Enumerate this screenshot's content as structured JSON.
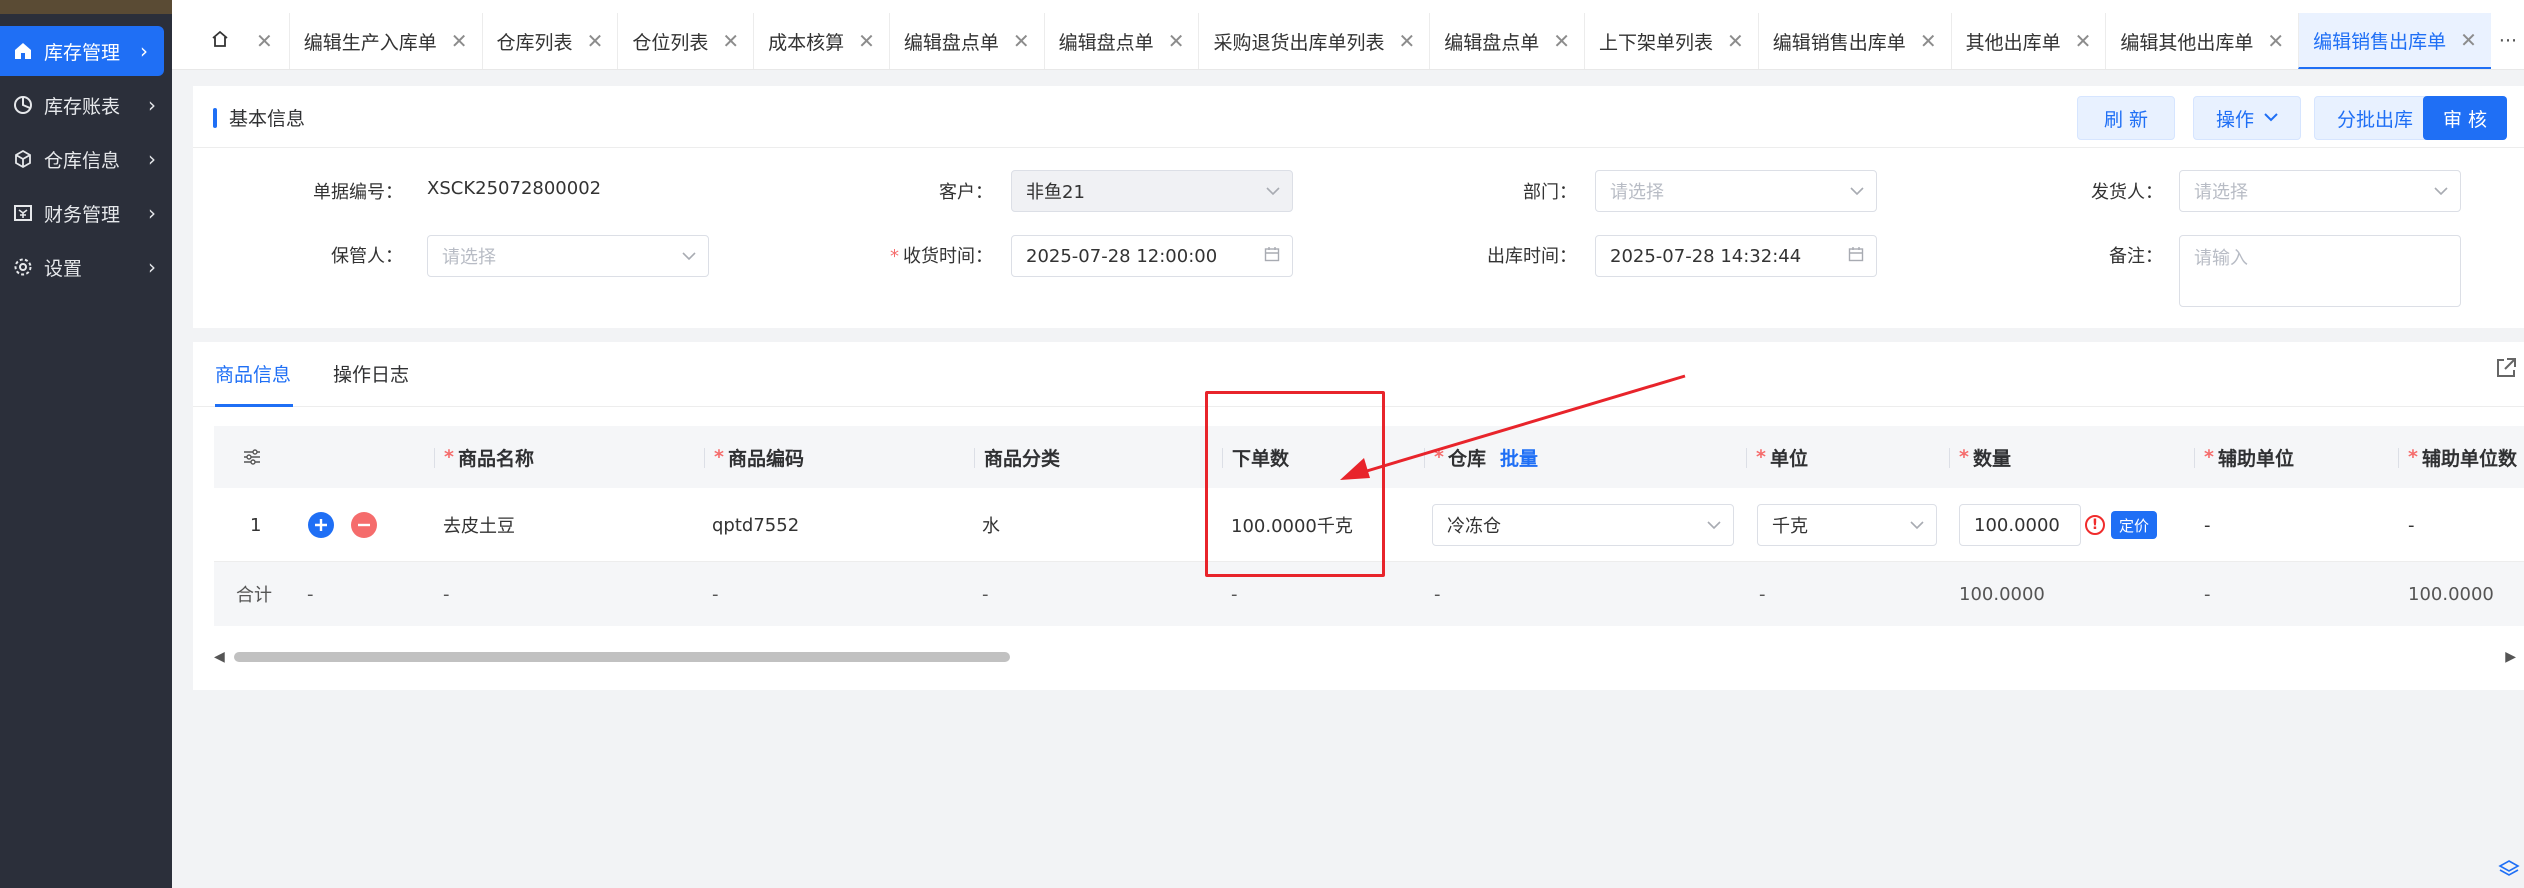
{
  "sidebar": {
    "items": [
      {
        "label": "库存管理",
        "icon": "home-icon"
      },
      {
        "label": "库存账表",
        "icon": "pie-chart-icon"
      },
      {
        "label": "仓库信息",
        "icon": "cube-icon"
      },
      {
        "label": "财务管理",
        "icon": "finance-icon"
      },
      {
        "label": "设置",
        "icon": "gear-icon"
      }
    ]
  },
  "tabs": [
    {
      "label": "编辑生产入库单"
    },
    {
      "label": "仓库列表"
    },
    {
      "label": "仓位列表"
    },
    {
      "label": "成本核算"
    },
    {
      "label": "编辑盘点单"
    },
    {
      "label": "编辑盘点单"
    },
    {
      "label": "采购退货出库单列表"
    },
    {
      "label": "编辑盘点单"
    },
    {
      "label": "上下架单列表"
    },
    {
      "label": "编辑销售出库单"
    },
    {
      "label": "其他出库单"
    },
    {
      "label": "编辑其他出库单"
    },
    {
      "label": "编辑销售出库单"
    }
  ],
  "tabs_more": "···",
  "basic": {
    "title": "基本信息",
    "buttons": {
      "refresh": "刷 新",
      "operate": "操作",
      "batch_out": "分批出库",
      "approve": "审 核"
    },
    "doc_no_label": "单据编号：",
    "doc_no": "XSCK25072800002",
    "customer_label": "客户：",
    "customer": "非鱼21",
    "department_label": "部门：",
    "department_ph": "请选择",
    "shipper_label": "发货人：",
    "shipper_ph": "请选择",
    "keeper_label": "保管人：",
    "keeper_ph": "请选择",
    "receive_time_label": "收货时间：",
    "receive_time": "2025-07-28 12:00:00",
    "out_time_label": "出库时间：",
    "out_time": "2025-07-28 14:32:44",
    "remark_label": "备注：",
    "remark_ph": "请输入"
  },
  "products": {
    "tabs": {
      "goods": "商品信息",
      "log": "操作日志"
    },
    "columns": {
      "name": "商品名称",
      "code": "商品编码",
      "category": "商品分类",
      "order_qty": "下单数",
      "warehouse": "仓库",
      "batch": "批量",
      "unit": "单位",
      "qty": "数量",
      "aux_unit": "辅助单位",
      "aux_unit_qty": "辅助单位数"
    },
    "row": {
      "index": "1",
      "name": "去皮土豆",
      "code": "qptd7552",
      "category": "水",
      "order_qty": "100.0000千克",
      "warehouse": "冷冻仓",
      "unit": "千克",
      "qty": "100.0000",
      "price_btn": "定价",
      "aux_unit": "-",
      "aux_unit_qty": "-"
    },
    "total": {
      "label": "合计",
      "dash": "-",
      "qty": "100.0000",
      "aux_qty": "100.0000"
    }
  },
  "colors": {
    "accent": "#1f6ff5",
    "annotation": "#e8242b",
    "sidebar": "#2b2f3a"
  }
}
